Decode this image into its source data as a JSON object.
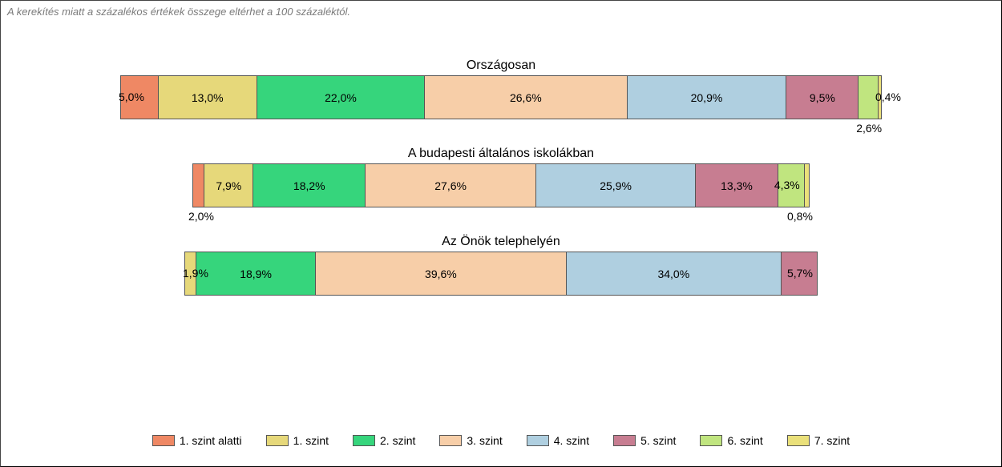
{
  "footnote": "A kerekítés miatt a százalékos értékek összege eltérhet a 100 százaléktól.",
  "legend": [
    {
      "label": "1. szint alatti",
      "colorClass": "c0"
    },
    {
      "label": "1. szint",
      "colorClass": "c1"
    },
    {
      "label": "2. szint",
      "colorClass": "c2"
    },
    {
      "label": "3. szint",
      "colorClass": "c3"
    },
    {
      "label": "4. szint",
      "colorClass": "c4"
    },
    {
      "label": "5. szint",
      "colorClass": "c5"
    },
    {
      "label": "6. szint",
      "colorClass": "c6"
    },
    {
      "label": "7. szint",
      "colorClass": "c7"
    }
  ],
  "bars": [
    {
      "title": "Országosan",
      "totalWidth": 950,
      "segments": [
        {
          "v": 5.0,
          "label": "5,0%",
          "c": "c0",
          "pos": "left"
        },
        {
          "v": 13.0,
          "label": "13,0%",
          "c": "c1",
          "pos": "in"
        },
        {
          "v": 22.0,
          "label": "22,0%",
          "c": "c2",
          "pos": "in"
        },
        {
          "v": 26.6,
          "label": "26,6%",
          "c": "c3",
          "pos": "in"
        },
        {
          "v": 20.9,
          "label": "20,9%",
          "c": "c4",
          "pos": "in"
        },
        {
          "v": 9.5,
          "label": "9,5%",
          "c": "c5",
          "pos": "in"
        },
        {
          "v": 2.6,
          "label": "2,6%",
          "c": "c6",
          "pos": "below-right"
        },
        {
          "v": 0.4,
          "label": "0,4%",
          "c": "c7",
          "pos": "right"
        }
      ]
    },
    {
      "title": "A budapesti általános iskolákban",
      "totalWidth": 770,
      "segments": [
        {
          "v": 2.0,
          "label": "2,0%",
          "c": "c0",
          "pos": "below-left"
        },
        {
          "v": 7.9,
          "label": "7,9%",
          "c": "c1",
          "pos": "in"
        },
        {
          "v": 18.2,
          "label": "18,2%",
          "c": "c2",
          "pos": "in"
        },
        {
          "v": 27.6,
          "label": "27,6%",
          "c": "c3",
          "pos": "in"
        },
        {
          "v": 25.9,
          "label": "25,9%",
          "c": "c4",
          "pos": "in"
        },
        {
          "v": 13.3,
          "label": "13,3%",
          "c": "c5",
          "pos": "in"
        },
        {
          "v": 4.3,
          "label": "4,3%",
          "c": "c6",
          "pos": "right-edge"
        },
        {
          "v": 0.8,
          "label": "0,8%",
          "c": "c7",
          "pos": "below-right"
        }
      ]
    },
    {
      "title": "Az Önök telephelyén",
      "totalWidth": 790,
      "segments": [
        {
          "v": 1.9,
          "label": "1,9%",
          "c": "c1",
          "pos": "left"
        },
        {
          "v": 18.9,
          "label": "18,9%",
          "c": "c2",
          "pos": "in"
        },
        {
          "v": 39.6,
          "label": "39,6%",
          "c": "c3",
          "pos": "in"
        },
        {
          "v": 34.0,
          "label": "34,0%",
          "c": "c4",
          "pos": "in"
        },
        {
          "v": 5.7,
          "label": "5,7%",
          "c": "c5",
          "pos": "right-edge"
        }
      ]
    }
  ],
  "chart_data": {
    "type": "bar",
    "stacked": true,
    "orientation": "horizontal",
    "unit": "percent",
    "categories": [
      "Országosan",
      "A budapesti általános iskolákban",
      "Az Önök telephelyén"
    ],
    "series": [
      {
        "name": "1. szint alatti",
        "values": [
          5.0,
          2.0,
          0.0
        ]
      },
      {
        "name": "1. szint",
        "values": [
          13.0,
          7.9,
          1.9
        ]
      },
      {
        "name": "2. szint",
        "values": [
          22.0,
          18.2,
          18.9
        ]
      },
      {
        "name": "3. szint",
        "values": [
          26.6,
          27.6,
          39.6
        ]
      },
      {
        "name": "4. szint",
        "values": [
          20.9,
          25.9,
          34.0
        ]
      },
      {
        "name": "5. szint",
        "values": [
          9.5,
          13.3,
          5.7
        ]
      },
      {
        "name": "6. szint",
        "values": [
          2.6,
          4.3,
          0.0
        ]
      },
      {
        "name": "7. szint",
        "values": [
          0.4,
          0.8,
          0.0
        ]
      }
    ],
    "title": "",
    "xlabel": "",
    "ylabel": ""
  }
}
